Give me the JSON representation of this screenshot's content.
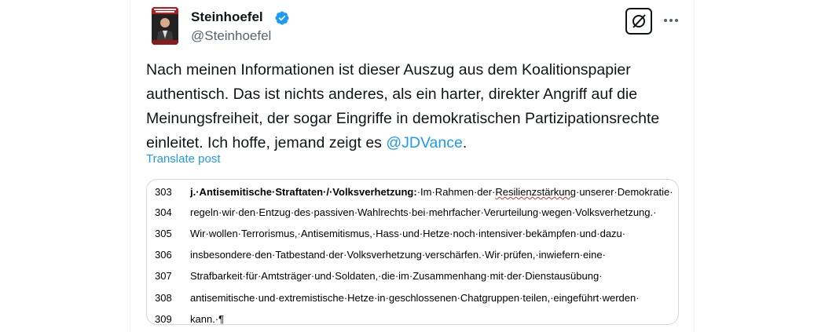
{
  "author": {
    "display_name": "Steinhoefel",
    "handle": "@Steinhoefel",
    "verified_color": "#1d9bf0"
  },
  "actions": {
    "grok_icon": "grok-icon",
    "more_icon": "more-horizontal-icon"
  },
  "post": {
    "text_main": "Nach meinen Informationen ist dieser Auszug aus dem Koalitionspapier authentisch. Das ist nichts anderes, als ein harter, direkter Angriff auf die Meinungsfreiheit, der sogar Eingriffe in demokratischen Partizipationsrechte einleitet. Ich hoffe, jemand zeigt es ",
    "mention": "@JDVance",
    "text_end": ".",
    "translate_label": "Translate post"
  },
  "document": {
    "lines": [
      {
        "num": "303",
        "bold": "j.·Antisemitische·Straftaten·/·Volksverhetzung:",
        "pre": "·Im·Rahmen·der·",
        "underlined": "Resilienzstärkung",
        "post": "·unserer·Demokratie·"
      },
      {
        "num": "304",
        "text": "regeln·wir·den·Entzug·des·passiven·Wahlrechts·bei·mehrfacher·Verurteilung·wegen·Volksverhetzung.·"
      },
      {
        "num": "305",
        "text": "Wir·wollen·Terrorismus,·Antisemitismus,·Hass·und·Hetze·noch·intensiver·bekämpfen·und·dazu·"
      },
      {
        "num": "306",
        "text": "insbesondere·den·Tatbestand·der·Volksverhetzung·verschärfen.·Wir·prüfen,·inwiefern·eine·"
      },
      {
        "num": "307",
        "text": "Strafbarkeit·für·Amtsträger·und·Soldaten,·die·im·Zusammenhang·mit·der·Dienstausübung·"
      },
      {
        "num": "308",
        "text": "antisemitische·und·extremistische·Hetze·in·geschlossenen·Chatgruppen·teilen,·eingeführt·werden·"
      },
      {
        "num": "309",
        "text": "kann.·¶"
      }
    ]
  }
}
